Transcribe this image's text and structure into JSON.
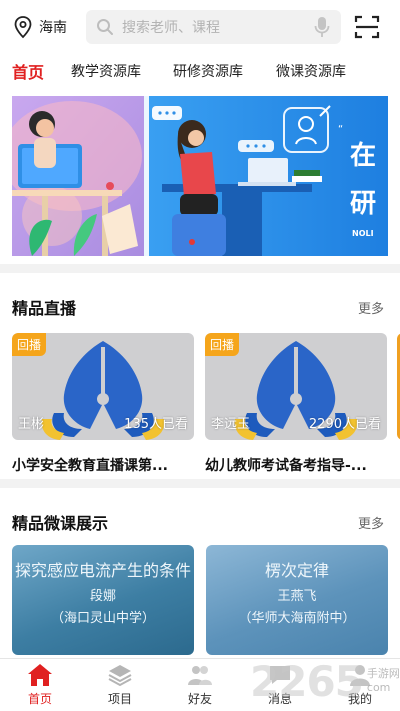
{
  "header": {
    "city": "海南",
    "search_placeholder": "搜索老师、课程",
    "icons": [
      "location-pin-icon",
      "search-icon",
      "microphone-icon",
      "scan-icon"
    ]
  },
  "tabs": [
    {
      "label": "首页",
      "active": true
    },
    {
      "label": "教学资源库",
      "active": false
    },
    {
      "label": "研修资源库",
      "active": false
    },
    {
      "label": "微课资源库",
      "active": false
    }
  ],
  "banner": {
    "text_large_1": "在",
    "text_large_2": "研",
    "text_small": "NOLI"
  },
  "live_section": {
    "title": "精品直播",
    "more": "更多",
    "cards": [
      {
        "badge": "回播",
        "teacher": "王彬",
        "viewers": "135人已看",
        "title": "小学安全教育直播课第..."
      },
      {
        "badge": "回播",
        "teacher": "李远玉",
        "viewers": "2290人已看",
        "title": "幼儿教师考试备考指导-..."
      }
    ]
  },
  "micro_section": {
    "title": "精品微课展示",
    "more": "更多",
    "cards": [
      {
        "line1": "探究感应电流产生的条件",
        "line2": "段娜",
        "line3": "（海口灵山中学）"
      },
      {
        "line1": "楞次定律",
        "line2": "王燕飞",
        "line3": "（华师大海南附中）"
      }
    ]
  },
  "bottom_nav": [
    {
      "label": "首页",
      "icon": "home-icon",
      "active": true
    },
    {
      "label": "项目",
      "icon": "layers-icon",
      "active": false
    },
    {
      "label": "好友",
      "icon": "friends-icon",
      "active": false
    },
    {
      "label": "消息",
      "icon": "message-icon",
      "active": false
    },
    {
      "label": "我的",
      "icon": "profile-icon",
      "active": false
    }
  ],
  "watermark": {
    "number": "2265",
    "suffix": "com",
    "line1": "手游网"
  },
  "colors": {
    "accent_red": "#e02020",
    "badge_orange": "#f5a51b",
    "banner_blue": "#2f8fe6"
  }
}
